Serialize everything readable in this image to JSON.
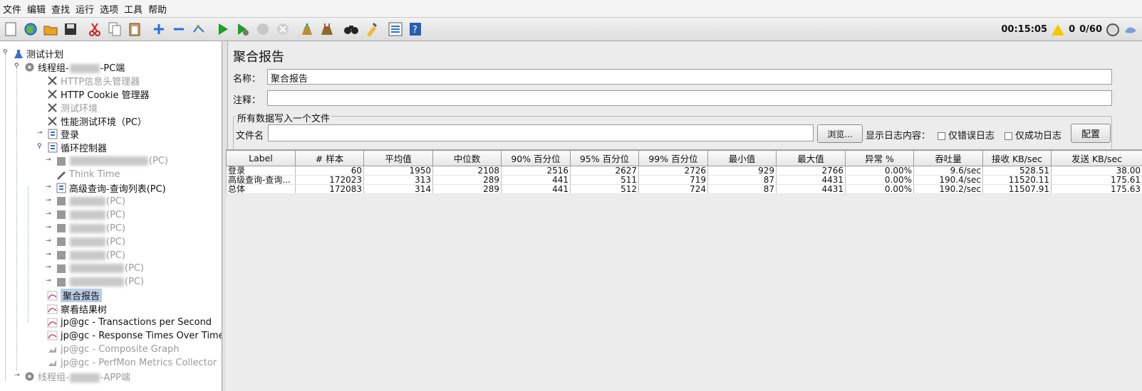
{
  "menu": [
    "文件",
    "编辑",
    "查找",
    "运行",
    "选项",
    "工具",
    "帮助"
  ],
  "toolbar": {
    "buttons": [
      "new-icon",
      "templates-icon",
      "open-icon",
      "save-icon",
      "cut-icon",
      "copy-icon",
      "paste-icon",
      "expand-icon",
      "collapse-icon",
      "toggle-icon",
      "start-icon",
      "start-no-pause-icon",
      "stop-icon",
      "shutdown-icon",
      "clear-icon",
      "clear-all-icon",
      "search-icon",
      "reset-search-icon",
      "function-helper-icon",
      "help-icon"
    ],
    "timer": "00:15:05",
    "warning_count": "0",
    "threads": "0/60"
  },
  "tree": [
    {
      "label": "测试计划",
      "indent": 0,
      "icon": "flask-icon",
      "state": "normal"
    },
    {
      "label_pre": "线程组-",
      "label_post": "-PC端",
      "indent": 1,
      "icon": "gear-icon",
      "state": "normal"
    },
    {
      "label": "HTTP信息头管理器",
      "indent": 2,
      "icon": "wrench-icon",
      "state": "disabled"
    },
    {
      "label": "HTTP Cookie 管理器",
      "indent": 2,
      "icon": "wrench-icon",
      "state": "normal"
    },
    {
      "label": "测试环境",
      "indent": 2,
      "icon": "wrench-icon",
      "state": "disabled"
    },
    {
      "label": "性能测试环境（PC）",
      "indent": 2,
      "icon": "wrench-icon",
      "state": "normal"
    },
    {
      "label": "登录",
      "indent": 2,
      "icon": "controller-icon",
      "state": "normal"
    },
    {
      "label": "循环控制器",
      "indent": 2,
      "icon": "controller-icon",
      "state": "normal"
    },
    {
      "label_post": "(PC)",
      "indent": 3,
      "icon": "sampler-icon",
      "state": "disabled"
    },
    {
      "label": "Think Time",
      "indent": 3,
      "icon": "pen-icon",
      "state": "disabled"
    },
    {
      "label": "高级查询-查询列表(PC)",
      "indent": 3,
      "icon": "controller-icon",
      "state": "normal"
    },
    {
      "label_post": "(PC)",
      "indent": 3,
      "icon": "sampler-icon",
      "state": "disabled"
    },
    {
      "label_post": "(PC)",
      "indent": 3,
      "icon": "sampler-icon",
      "state": "disabled"
    },
    {
      "label_post": "(PC)",
      "indent": 3,
      "icon": "sampler-icon",
      "state": "disabled"
    },
    {
      "label_post": "(PC)",
      "indent": 3,
      "icon": "sampler-icon",
      "state": "disabled"
    },
    {
      "label_post": "(PC)",
      "indent": 3,
      "icon": "sampler-icon",
      "state": "disabled"
    },
    {
      "label_post": "(PC)",
      "indent": 3,
      "icon": "sampler-icon",
      "state": "disabled"
    },
    {
      "label_post": "(PC)",
      "indent": 3,
      "icon": "sampler-icon",
      "state": "disabled"
    },
    {
      "label": "聚合报告",
      "indent": 2,
      "icon": "graph-icon",
      "state": "selected"
    },
    {
      "label": "察看结果树",
      "indent": 2,
      "icon": "graph-icon",
      "state": "normal"
    },
    {
      "label": "jp@gc - Transactions per Second",
      "indent": 2,
      "icon": "graph-icon",
      "state": "normal"
    },
    {
      "label": "jp@gc - Response Times Over Time",
      "indent": 2,
      "icon": "graph-icon",
      "state": "normal"
    },
    {
      "label": "jp@gc - Composite Graph",
      "indent": 2,
      "icon": "chart-icon",
      "state": "disabled"
    },
    {
      "label": "jp@gc - PerfMon Metrics Collector",
      "indent": 2,
      "icon": "chart-icon",
      "state": "disabled"
    },
    {
      "label_pre": "线程组-",
      "label_post": "-APP端",
      "indent": 1,
      "icon": "gear-icon",
      "state": "disabled"
    }
  ],
  "panel": {
    "title": "聚合报告",
    "name_label": "名称：",
    "name_value": "聚合报告",
    "comment_label": "注释：",
    "comment_value": "",
    "file_group_legend": "所有数据写入一个文件",
    "file_label": "文件名",
    "file_value": "",
    "browse_label": "浏览...",
    "log_label": "显示日志内容：",
    "errors_only": "仅错误日志",
    "success_only": "仅成功日志",
    "configure_label": "配置"
  },
  "table": {
    "headers": [
      "Label",
      "# 样本",
      "平均值",
      "中位数",
      "90% 百分位",
      "95% 百分位",
      "99% 百分位",
      "最小值",
      "最大值",
      "异常 %",
      "吞吐量",
      "接收 KB/sec",
      "发送 KB/sec"
    ],
    "rows": [
      [
        "登录",
        "60",
        "1950",
        "2108",
        "2516",
        "2627",
        "2726",
        "929",
        "2766",
        "0.00%",
        "9.6/sec",
        "528.51",
        "38.00"
      ],
      [
        "高级查询-查询...",
        "172023",
        "313",
        "289",
        "441",
        "511",
        "719",
        "87",
        "4431",
        "0.00%",
        "190.4/sec",
        "11520.11",
        "175.61"
      ],
      [
        "总体",
        "172083",
        "314",
        "289",
        "441",
        "512",
        "724",
        "87",
        "4431",
        "0.00%",
        "190.2/sec",
        "11507.91",
        "175.63"
      ]
    ]
  }
}
